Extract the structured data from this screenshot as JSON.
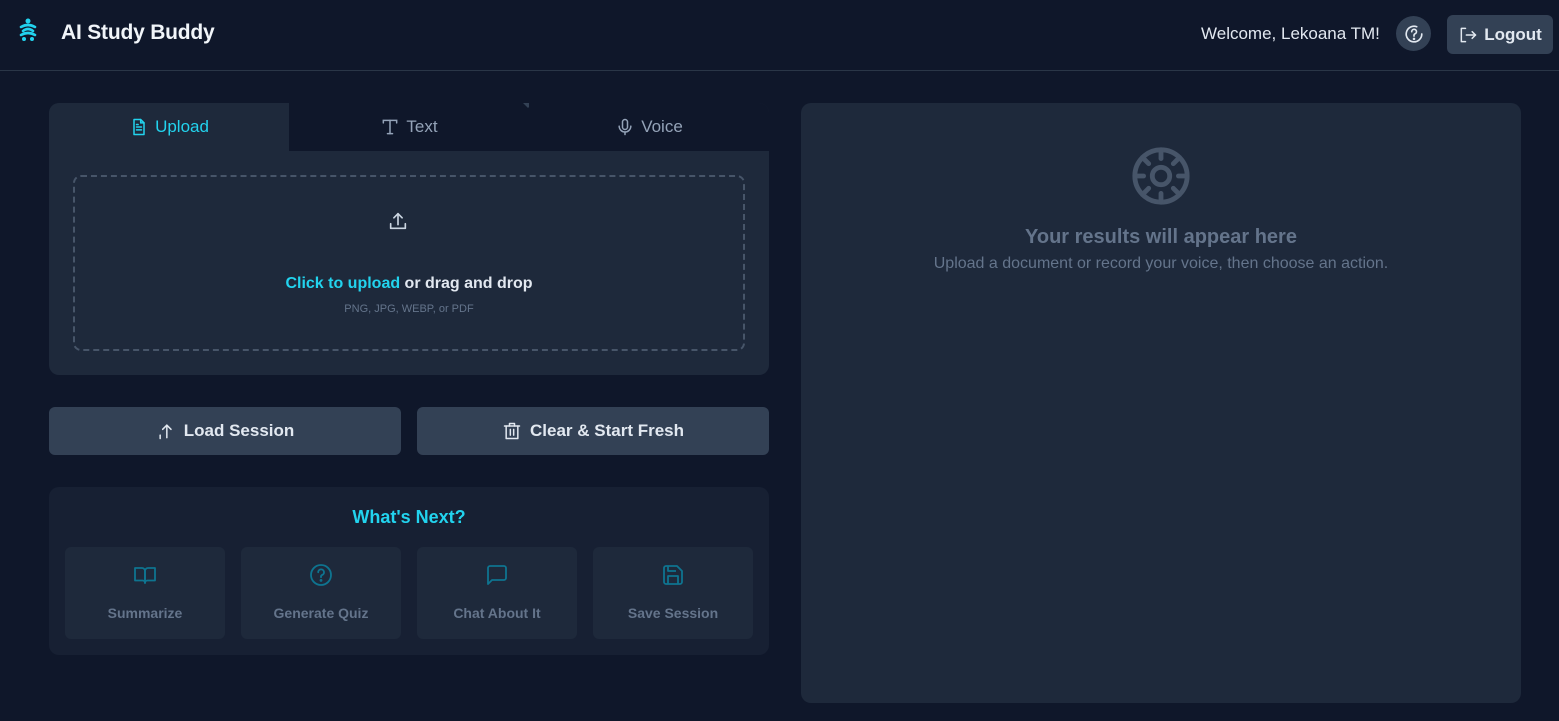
{
  "header": {
    "app_title": "AI Study Buddy",
    "welcome_text": "Welcome, Lekoana TM!",
    "logout_label": "Logout",
    "icons": {
      "logo": "study-buddy-logo-icon",
      "help": "help-circle-icon",
      "logout": "logout-icon"
    }
  },
  "input_panel": {
    "tabs": [
      {
        "label": "Upload",
        "icon": "file-text-icon",
        "active": true
      },
      {
        "label": "Text",
        "icon": "type-icon",
        "active": false
      },
      {
        "label": "Voice",
        "icon": "microphone-icon",
        "active": false
      }
    ],
    "dropzone": {
      "link_text": "Click to upload",
      "rest_text": " or drag and drop",
      "formats": "PNG, JPG, WEBP, or PDF",
      "icon": "upload-icon"
    }
  },
  "session_buttons": {
    "load_label": "Load Session",
    "clear_label": "Clear & Start Fresh"
  },
  "whats_next": {
    "title": "What's Next?",
    "actions": [
      {
        "label": "Summarize",
        "icon": "book-open-icon"
      },
      {
        "label": "Generate Quiz",
        "icon": "help-circle-icon"
      },
      {
        "label": "Chat About It",
        "icon": "message-square-icon"
      },
      {
        "label": "Save Session",
        "icon": "save-icon"
      }
    ]
  },
  "results": {
    "title": "Your results will appear here",
    "subtitle": "Upload a document or record your voice, then choose an action.",
    "icon": "gear-icon"
  },
  "colors": {
    "background": "#0f172a",
    "panel": "#1e293b",
    "accent": "#22d3ee",
    "button": "#334155",
    "muted": "#64748b"
  }
}
